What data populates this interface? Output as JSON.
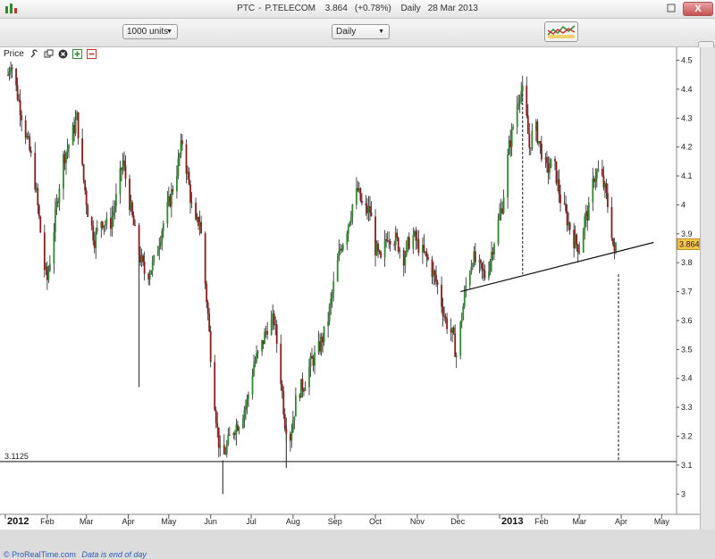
{
  "window": {
    "symbol": "PTC",
    "name": "P.TELECOM",
    "last_price": "3.864",
    "change": "(+0.78%)",
    "interval": "Daily",
    "date": "28 Mar 2013",
    "close_label": "X"
  },
  "toolbar": {
    "units_value": "1000 units",
    "interval_value": "Daily"
  },
  "panel": {
    "label": "Price"
  },
  "footer": {
    "copyright": "ProRealTime.com",
    "note": "Data is end of day"
  },
  "colors": {
    "bullish": "#2f8a2f",
    "bearish": "#8b1c1c",
    "price_tag": "#f6c64a",
    "trendline": "#111111"
  },
  "chart_data": {
    "type": "candlestick",
    "title": "",
    "ylim": [
      2.97,
      4.52
    ],
    "y_ticks": [
      3,
      3.1,
      3.2,
      3.3,
      3.4,
      3.5,
      3.6,
      3.7,
      3.8,
      3.9,
      4,
      4.1,
      4.2,
      4.3,
      4.4,
      4.5
    ],
    "y_tick_labels": [
      "3",
      "3.1",
      "3.2",
      "3.3",
      "3.4",
      "3.5",
      "3.6",
      "3.7",
      "3.8",
      "3.9",
      "4",
      "4.1",
      "4.2",
      "4.3",
      "4.4",
      "4.5"
    ],
    "x_labels": [
      {
        "label": "2012",
        "date": "2012-01-01",
        "bold": true
      },
      {
        "label": "Feb",
        "date": "2012-02-01"
      },
      {
        "label": "Mar",
        "date": "2012-03-01"
      },
      {
        "label": "Apr",
        "date": "2012-04-01"
      },
      {
        "label": "May",
        "date": "2012-05-01"
      },
      {
        "label": "Jun",
        "date": "2012-06-01"
      },
      {
        "label": "Jul",
        "date": "2012-07-01"
      },
      {
        "label": "Aug",
        "date": "2012-08-01"
      },
      {
        "label": "Sep",
        "date": "2012-09-01"
      },
      {
        "label": "Oct",
        "date": "2012-10-01"
      },
      {
        "label": "Nov",
        "date": "2012-11-01"
      },
      {
        "label": "Dec",
        "date": "2012-12-01"
      },
      {
        "label": "2013",
        "date": "2013-01-01",
        "bold": true
      },
      {
        "label": "Feb",
        "date": "2013-02-01"
      },
      {
        "label": "Mar",
        "date": "2013-03-01"
      },
      {
        "label": "Apr",
        "date": "2013-04-01"
      },
      {
        "label": "May",
        "date": "2013-05-01"
      }
    ],
    "x_range": [
      "2012-01-01",
      "2013-05-12"
    ],
    "price_path": [
      [
        "2012-01-03",
        4.45
      ],
      [
        "2012-01-05",
        4.5
      ],
      [
        "2012-01-10",
        4.38
      ],
      [
        "2012-01-16",
        4.25
      ],
      [
        "2012-01-22",
        4.12
      ],
      [
        "2012-01-26",
        3.95
      ],
      [
        "2012-01-30",
        3.78
      ],
      [
        "2012-02-01",
        3.74
      ],
      [
        "2012-02-06",
        3.92
      ],
      [
        "2012-02-12",
        4.15
      ],
      [
        "2012-02-18",
        4.22
      ],
      [
        "2012-02-23",
        4.3
      ],
      [
        "2012-02-27",
        4.12
      ],
      [
        "2012-03-02",
        3.98
      ],
      [
        "2012-03-07",
        3.88
      ],
      [
        "2012-03-12",
        3.95
      ],
      [
        "2012-03-18",
        3.92
      ],
      [
        "2012-03-23",
        4.02
      ],
      [
        "2012-03-28",
        4.15
      ],
      [
        "2012-04-03",
        3.98
      ],
      [
        "2012-04-08",
        3.85
      ],
      [
        "2012-04-14",
        3.75
      ],
      [
        "2012-04-20",
        3.8
      ],
      [
        "2012-04-26",
        3.92
      ],
      [
        "2012-05-02",
        4.02
      ],
      [
        "2012-05-07",
        4.12
      ],
      [
        "2012-05-11",
        4.22
      ],
      [
        "2012-05-15",
        4.1
      ],
      [
        "2012-05-20",
        3.92
      ],
      [
        "2012-05-24",
        3.95
      ],
      [
        "2012-05-30",
        3.62
      ],
      [
        "2012-06-02",
        3.42
      ],
      [
        "2012-06-06",
        3.22
      ],
      [
        "2012-06-09",
        3.1
      ],
      [
        "2012-06-12",
        3.15
      ],
      [
        "2012-06-17",
        3.22
      ],
      [
        "2012-06-22",
        3.25
      ],
      [
        "2012-06-28",
        3.32
      ],
      [
        "2012-07-03",
        3.45
      ],
      [
        "2012-07-08",
        3.5
      ],
      [
        "2012-07-13",
        3.58
      ],
      [
        "2012-07-18",
        3.6
      ],
      [
        "2012-07-22",
        3.45
      ],
      [
        "2012-07-26",
        3.25
      ],
      [
        "2012-07-30",
        3.2
      ],
      [
        "2012-08-04",
        3.35
      ],
      [
        "2012-08-09",
        3.38
      ],
      [
        "2012-08-14",
        3.45
      ],
      [
        "2012-08-20",
        3.5
      ],
      [
        "2012-08-26",
        3.58
      ],
      [
        "2012-08-31",
        3.72
      ],
      [
        "2012-09-05",
        3.85
      ],
      [
        "2012-09-10",
        3.92
      ],
      [
        "2012-09-14",
        4.0
      ],
      [
        "2012-09-18",
        4.05
      ],
      [
        "2012-09-22",
        3.98
      ],
      [
        "2012-09-27",
        3.98
      ],
      [
        "2012-10-01",
        3.85
      ],
      [
        "2012-10-05",
        3.8
      ],
      [
        "2012-10-10",
        3.9
      ],
      [
        "2012-10-16",
        3.88
      ],
      [
        "2012-10-22",
        3.82
      ],
      [
        "2012-10-28",
        3.9
      ],
      [
        "2012-11-03",
        3.85
      ],
      [
        "2012-11-10",
        3.8
      ],
      [
        "2012-11-16",
        3.72
      ],
      [
        "2012-11-22",
        3.6
      ],
      [
        "2012-11-27",
        3.55
      ],
      [
        "2012-11-30",
        3.48
      ],
      [
        "2012-12-03",
        3.58
      ],
      [
        "2012-12-07",
        3.72
      ],
      [
        "2012-12-12",
        3.82
      ],
      [
        "2012-12-17",
        3.78
      ],
      [
        "2012-12-22",
        3.75
      ],
      [
        "2012-12-28",
        3.88
      ],
      [
        "2013-01-03",
        4.0
      ],
      [
        "2013-01-08",
        4.2
      ],
      [
        "2013-01-13",
        4.32
      ],
      [
        "2013-01-16",
        4.4
      ],
      [
        "2013-01-19",
        4.38
      ],
      [
        "2013-01-23",
        4.2
      ],
      [
        "2013-01-27",
        4.28
      ],
      [
        "2013-01-31",
        4.2
      ],
      [
        "2013-02-05",
        4.12
      ],
      [
        "2013-02-10",
        4.15
      ],
      [
        "2013-02-15",
        4.02
      ],
      [
        "2013-02-20",
        3.95
      ],
      [
        "2013-02-25",
        3.88
      ],
      [
        "2013-03-01",
        3.85
      ],
      [
        "2013-03-05",
        3.95
      ],
      [
        "2013-03-08",
        3.98
      ],
      [
        "2013-03-12",
        4.1
      ],
      [
        "2013-03-16",
        4.12
      ],
      [
        "2013-03-20",
        4.05
      ],
      [
        "2013-03-24",
        3.95
      ],
      [
        "2013-03-27",
        3.82
      ],
      [
        "2013-03-28",
        3.864
      ]
    ],
    "spikes": [
      {
        "date": "2012-04-09",
        "low": 3.37
      },
      {
        "date": "2012-07-27",
        "low": 3.09
      },
      {
        "date": "2012-06-10",
        "low": 3.0
      }
    ],
    "horizontal_line": {
      "value": 3.1125,
      "label": "3.1125"
    },
    "trendline": {
      "start": [
        "2012-12-03",
        3.7
      ],
      "end": [
        "2013-04-25",
        3.87
      ]
    },
    "projections": [
      {
        "date": "2013-01-18",
        "from": 4.4,
        "to": 3.76
      },
      {
        "date": "2013-03-30",
        "from": 3.76,
        "to": 3.1125
      }
    ],
    "last_price_tag": {
      "value": 3.864,
      "label": "3.864"
    }
  }
}
